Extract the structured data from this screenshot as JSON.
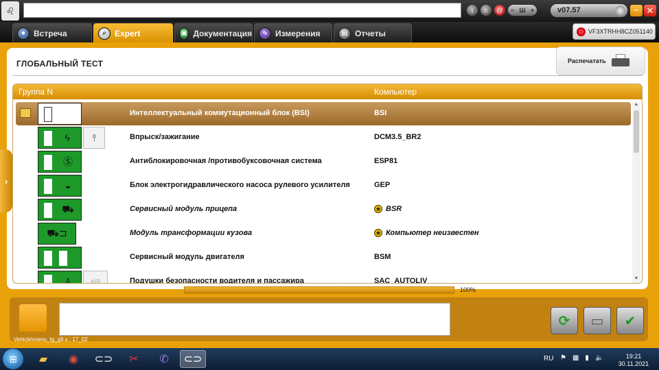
{
  "topbar": {
    "version": "v07.57",
    "min_symbol": "–",
    "close_symbol": "✕"
  },
  "tabs": [
    {
      "label": "Встреча",
      "active": false
    },
    {
      "label": "Expert",
      "active": true
    },
    {
      "label": "Документация",
      "active": false
    },
    {
      "label": "Измерения",
      "active": false
    },
    {
      "label": "Отчеты",
      "active": false
    }
  ],
  "vin": "VF3XTRHH8CZ051140",
  "page": {
    "title": "ГЛОБАЛЬНЫЙ ТЕСТ",
    "print_label": "Распечатать"
  },
  "table": {
    "columns": [
      "Группа N",
      "Компьютер"
    ],
    "rows": [
      {
        "name": "Интеллектуальный коммутационный блок (BSI)",
        "computer": "BSI",
        "selected": true,
        "italic": false,
        "star": false
      },
      {
        "name": "Впрыск/зажигание",
        "computer": "DCM3.5_BR2",
        "selected": false,
        "italic": false,
        "star": false
      },
      {
        "name": "Антиблокировочная /противобуксовочная система",
        "computer": "ESP81",
        "selected": false,
        "italic": false,
        "star": false
      },
      {
        "name": "Блок электрогидравлического насоса рулевого усилителя",
        "computer": "GEP",
        "selected": false,
        "italic": false,
        "star": false
      },
      {
        "name": "Сервисный модуль прицепа",
        "computer": "BSR",
        "selected": false,
        "italic": true,
        "star": true
      },
      {
        "name": "Модуль трансформации кузова",
        "computer": "Компьютер неизвестен",
        "selected": false,
        "italic": true,
        "star": true
      },
      {
        "name": "Сервисный модуль двигателя",
        "computer": "BSM",
        "selected": false,
        "italic": false,
        "star": false
      },
      {
        "name": "Подушки безопасности водителя и пассажира",
        "computer": "SAC_AUTOLIV",
        "selected": false,
        "italic": false,
        "star": false
      }
    ]
  },
  "progress": {
    "value": 1.0,
    "label": "100%"
  },
  "status_line": "Vehicle\\menu_tg_g9.s : 17_02",
  "taskbar": {
    "lang": "RU",
    "time": "19:21",
    "date": "30.11.2021"
  },
  "colors": {
    "accent": "#e9a10a",
    "selected_row": "#a8743a"
  }
}
